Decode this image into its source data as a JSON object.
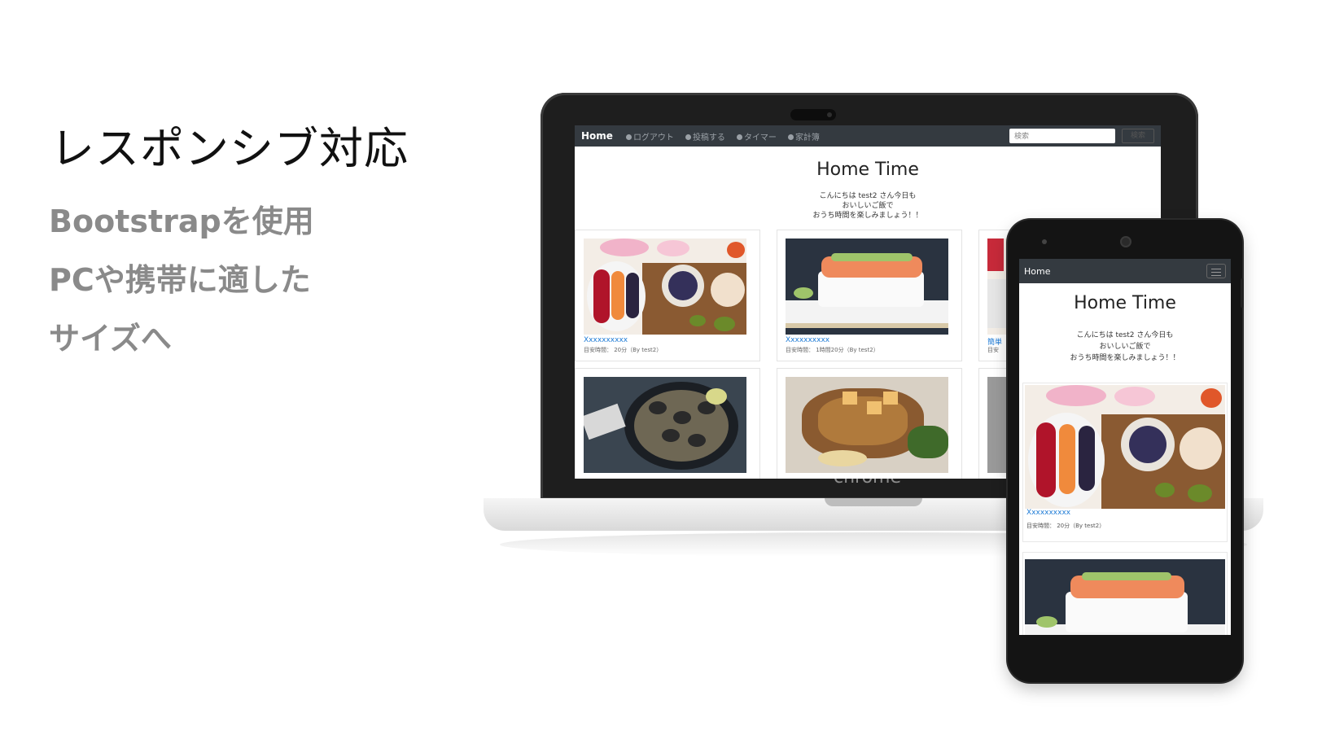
{
  "slide": {
    "heading": "レスポンシブ対応",
    "bullets": [
      "Bootstrapを使用",
      "PCや携帯に適した",
      "サイズへ"
    ]
  },
  "laptop": {
    "camera_label": "chrome",
    "nav": {
      "brand": "Home",
      "items": [
        "ログアウト",
        "投稿する",
        "タイマー",
        "家計簿"
      ],
      "search_placeholder": "検索",
      "search_button": "検索"
    },
    "site_title": "Home Time",
    "greeting": [
      "こんにちは test2 さん今日も",
      "おいしいご飯で",
      "おうち時間を楽しみましょう！！"
    ],
    "cards": [
      {
        "title": "Xxxxxxxxxx",
        "meta": "目安時間： 20分（By test2）",
        "image": "berry-bowl-photo"
      },
      {
        "title": "Xxxxxxxxxx",
        "meta": "目安時間： 1時間20分（By test2）",
        "image": "salmon-rice-photo"
      },
      {
        "title": "簡単",
        "meta": "目安",
        "image": "partial-photo"
      },
      {
        "title": "",
        "meta": "",
        "image": "clam-pan-photo"
      },
      {
        "title": "",
        "meta": "",
        "image": "grilled-pork-photo"
      },
      {
        "title": "",
        "meta": "",
        "image": "partial-photo"
      }
    ]
  },
  "phone": {
    "nav": {
      "brand": "Home"
    },
    "site_title": "Home Time",
    "greeting": [
      "こんにちは test2 さん今日も",
      "おいしいご飯で",
      "おうち時間を楽しみましょう！！"
    ],
    "cards": [
      {
        "title": "Xxxxxxxxxx",
        "meta": "目安時間： 20分（By test2）",
        "image": "berry-bowl-photo"
      },
      {
        "title": "",
        "meta": "",
        "image": "salmon-rice-photo"
      }
    ]
  },
  "colors": {
    "navbar": "#343a40",
    "link": "#1e7bd6",
    "bullet_text": "#8a8a8a"
  }
}
